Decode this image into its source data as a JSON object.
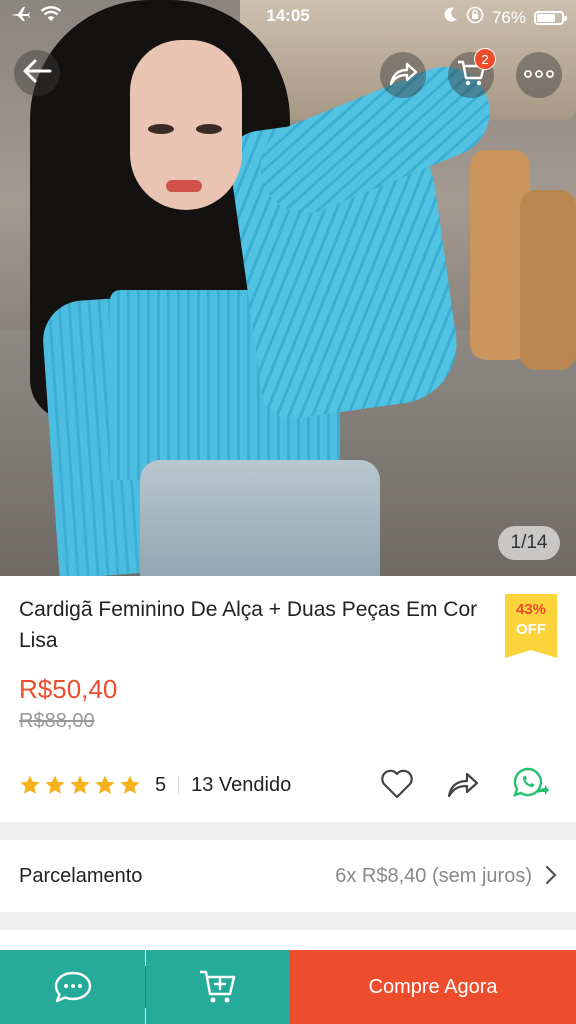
{
  "status_bar": {
    "time": "14:05",
    "battery_percent": "76%",
    "battery_level": 0.76,
    "icons": [
      "airplane-icon",
      "wifi-icon",
      "moon-icon",
      "rotation-lock-icon",
      "battery-icon"
    ]
  },
  "top_bar": {
    "back_icon": "back-arrow-icon",
    "share_icon": "share-icon",
    "cart_icon": "cart-icon",
    "cart_badge": "2",
    "more_icon": "more-icon"
  },
  "gallery": {
    "counter": "1/14"
  },
  "product": {
    "title": "Cardigã Feminino De Alça + Duas Peças Em Cor Lisa",
    "discount_pct": "43%",
    "discount_label": "OFF",
    "price": "R$50,40",
    "original_price": "R$88,00",
    "rating": 5,
    "rating_label": "5",
    "sold": "13 Vendido"
  },
  "installments": {
    "label": "Parcelamento",
    "value": "6x R$8,40 (sem juros)"
  },
  "bottom_bar": {
    "buy_label": "Compre Agora"
  },
  "colors": {
    "brand_orange": "#ee4d2d",
    "teal": "#26aa99",
    "star": "#f6b21c",
    "discount_bg": "#fbd33a",
    "whatsapp": "#25c16f"
  }
}
